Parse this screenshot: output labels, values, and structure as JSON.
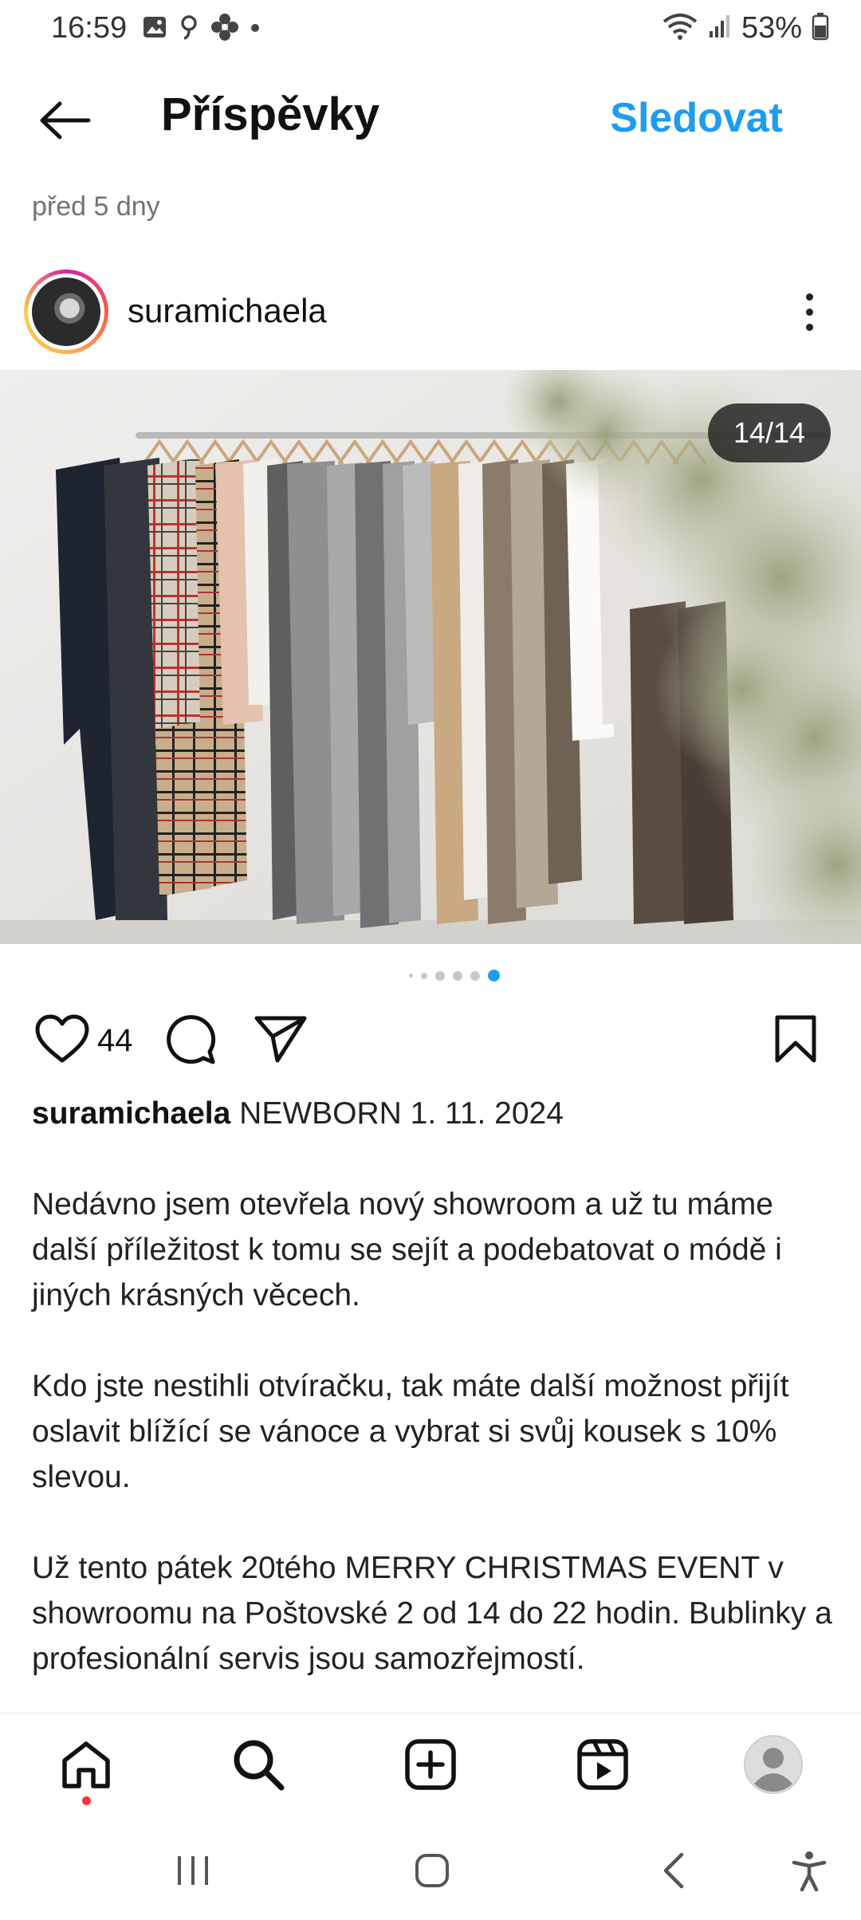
{
  "status_bar": {
    "time": "16:59",
    "battery": "53%",
    "icons": [
      "gallery-icon",
      "threads-icon",
      "flower-icon",
      "dot-icon",
      "wifi-icon",
      "signal-icon",
      "battery-icon"
    ]
  },
  "header": {
    "title": "Příspěvky",
    "follow_label": "Sledovat",
    "back_icon": "arrow-left-icon"
  },
  "post": {
    "time_ago": "před 5 dny",
    "author": "suramichaela",
    "image_counter": "14/14",
    "carousel": {
      "total_dots": 6,
      "active_index": 5
    },
    "likes": "44",
    "caption": {
      "user": "suramichaela",
      "headline": "NEWBORN 1. 11. 2024",
      "paragraphs": [
        "Nedávno jsem otevřela nový showroom a už tu máme další příležitost k tomu se sejít a podebatovat o módě i jiných krásných věcech.",
        "Kdo jste nestihli otvíračku, tak máte další možnost přijít oslavit blížící se vánoce a vybrat si svůj kousek s 10% slevou.",
        "Už tento pátek 20tého MERRY CHRISTMAS EVENT v showroomu na Poštovské 2 od 14 do 22 hodin. Bublinky a profesionální servis jsou samozřejmostí."
      ]
    }
  },
  "bottom_nav": [
    "home-icon",
    "search-icon",
    "create-icon",
    "reels-icon",
    "profile-icon"
  ],
  "system_nav": [
    "recents-icon",
    "home-button-icon",
    "back-icon",
    "accessibility-icon"
  ],
  "colors": {
    "accent": "#1e9cf0",
    "notification": "#ff3040",
    "text": "#111111",
    "muted": "#737373"
  }
}
